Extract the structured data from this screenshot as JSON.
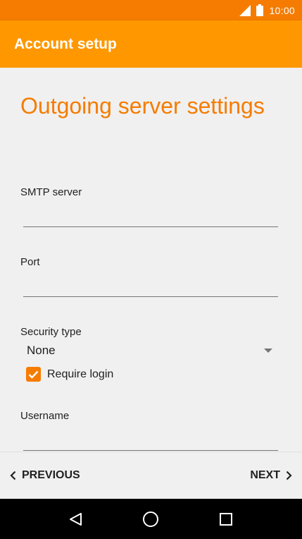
{
  "status_bar": {
    "time": "10:00"
  },
  "app_bar": {
    "title": "Account setup"
  },
  "page": {
    "title": "Outgoing server settings"
  },
  "fields": {
    "smtp_server": {
      "label": "SMTP server",
      "value": ""
    },
    "port": {
      "label": "Port",
      "value": ""
    },
    "security_type": {
      "label": "Security type",
      "value": "None"
    },
    "require_login": {
      "label": "Require login",
      "checked": true
    },
    "username": {
      "label": "Username",
      "value": ""
    }
  },
  "nav": {
    "previous_label": "PREVIOUS",
    "next_label": "NEXT"
  },
  "colors": {
    "status_bar": "#f57c00",
    "app_bar": "#ff9800",
    "accent": "#f57c00"
  }
}
